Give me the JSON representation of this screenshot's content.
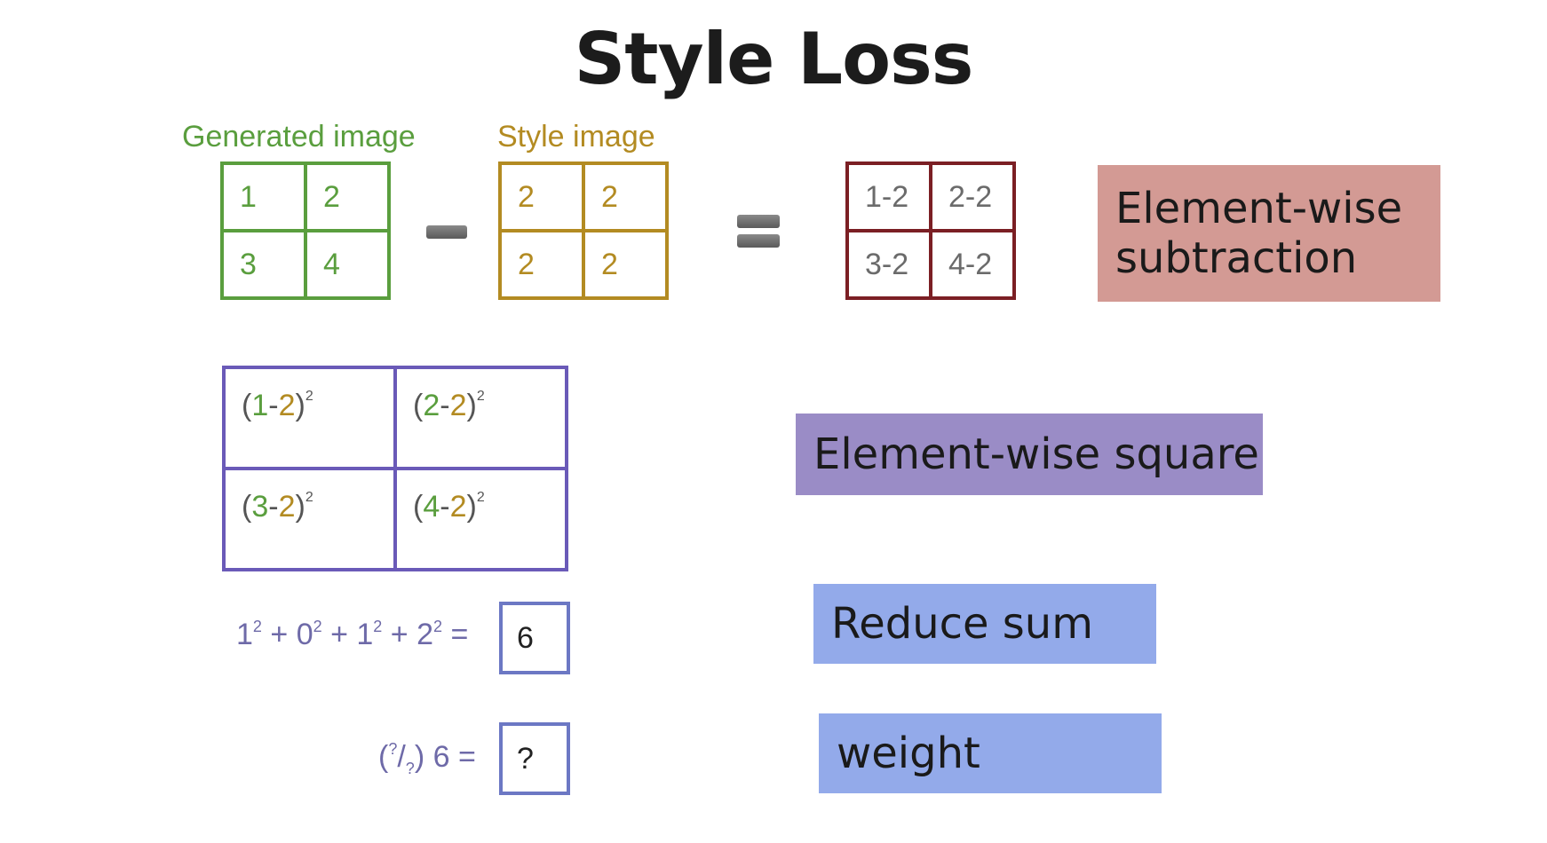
{
  "title": "Style Loss",
  "generated": {
    "label": "Generated image",
    "cells": [
      "1",
      "2",
      "3",
      "4"
    ],
    "color": "#5a9e3e"
  },
  "style": {
    "label": "Style image",
    "cells": [
      "2",
      "2",
      "2",
      "2"
    ],
    "color": "#b38b22"
  },
  "difference": {
    "cells": [
      "1-2",
      "2-2",
      "3-2",
      "4-2"
    ],
    "color": "#7b1f24"
  },
  "squares": {
    "color": "#6a5ab8",
    "cells": [
      {
        "open": "(",
        "g": "1",
        "dash": "-",
        "s": "2",
        "close": ")",
        "exp": "2"
      },
      {
        "open": "(",
        "g": "2",
        "dash": "-",
        "s": "2",
        "close": ")",
        "exp": "2"
      },
      {
        "open": "(",
        "g": "3",
        "dash": "-",
        "s": "2",
        "close": ")",
        "exp": "2"
      },
      {
        "open": "(",
        "g": "4",
        "dash": "-",
        "s": "2",
        "close": ")",
        "exp": "2"
      }
    ]
  },
  "sum": {
    "terms": [
      {
        "base": "1",
        "exp": "2",
        "op": " + "
      },
      {
        "base": "0",
        "exp": "2",
        "op": " + "
      },
      {
        "base": "1",
        "exp": "2",
        "op": " + "
      },
      {
        "base": "2",
        "exp": "2",
        "op": " ="
      }
    ],
    "result": "6"
  },
  "weighted": {
    "open": "(",
    "num": "?",
    "slash": "/",
    "den": "?",
    "close": ")",
    "value": " 6 =",
    "result": "?"
  },
  "tags": {
    "subtraction": "Element-wise subtraction",
    "square": "Element-wise square",
    "reduce": "Reduce sum",
    "weight": "weight"
  },
  "colors": {
    "subtraction_bg": "#d39a94",
    "square_bg": "#9a8cc6",
    "reduce_bg": "#93aaea",
    "weight_bg": "#93aaea"
  }
}
